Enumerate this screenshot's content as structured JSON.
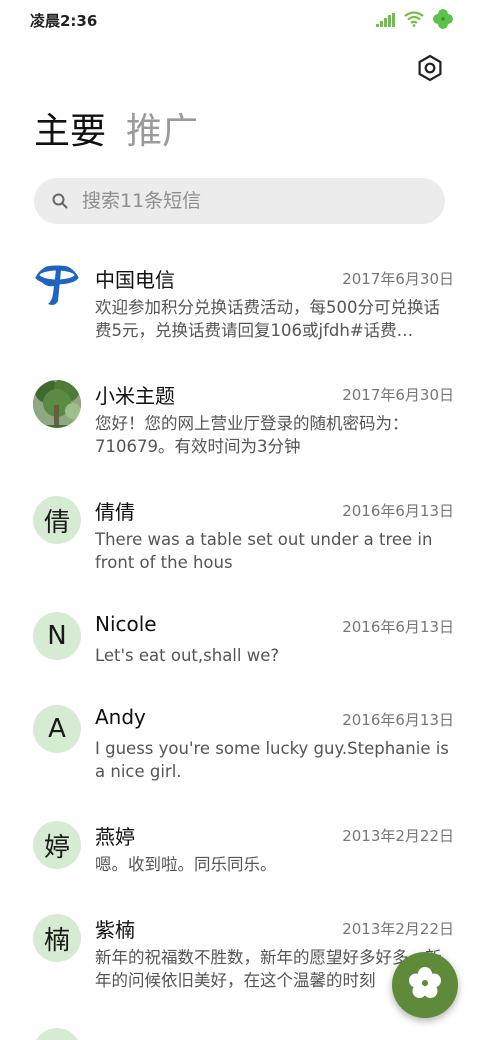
{
  "status_bar": {
    "time": "凌晨2:36",
    "icons": [
      "signal-icon",
      "wifi-icon",
      "clover-icon"
    ]
  },
  "header": {
    "settings_icon": "settings-icon",
    "tabs": [
      {
        "label": "主要",
        "active": true
      },
      {
        "label": "推广",
        "active": false
      }
    ]
  },
  "search": {
    "placeholder": "搜索11条短信",
    "value": ""
  },
  "messages": [
    {
      "avatar_type": "logo",
      "avatar_text": "",
      "name": "中国电信",
      "date": "2017年6月30日",
      "preview": "欢迎参加积分兑换话费活动，每500分可兑换话费5元，兑换话费请回复106或jfdh#话费…"
    },
    {
      "avatar_type": "photo",
      "avatar_text": "",
      "name": "小米主题",
      "date": "2017年6月30日",
      "preview": "您好！您的网上营业厅登录的随机密码为：710679。有效时间为3分钟"
    },
    {
      "avatar_type": "letter",
      "avatar_text": "倩",
      "name": "倩倩",
      "date": "2016年6月13日",
      "preview": "There was a table set out under a tree in front of the hous"
    },
    {
      "avatar_type": "letter",
      "avatar_text": "N",
      "name": "Nicole",
      "date": "2016年6月13日",
      "preview": "Let's eat out,shall we?"
    },
    {
      "avatar_type": "letter",
      "avatar_text": "A",
      "name": "Andy",
      "date": "2016年6月13日",
      "preview": "I guess you're some lucky guy.Stephanie is a nice girl."
    },
    {
      "avatar_type": "letter",
      "avatar_text": "婷",
      "name": "燕婷",
      "date": "2013年2月22日",
      "preview": "嗯。收到啦。同乐同乐。"
    },
    {
      "avatar_type": "letter",
      "avatar_text": "楠",
      "name": "紫楠",
      "date": "2013年2月22日",
      "preview": "新年的祝福数不胜数，新年的愿望好多好多，新年的问候依旧美好，在这个温馨的时刻"
    }
  ],
  "fab": {
    "icon": "flower-icon"
  },
  "colors": {
    "avatar_bg": "#d6ecd2",
    "fab_bg": "#5e8a3a",
    "search_bg": "#ececec",
    "tab_inactive": "#9a9a9a"
  }
}
